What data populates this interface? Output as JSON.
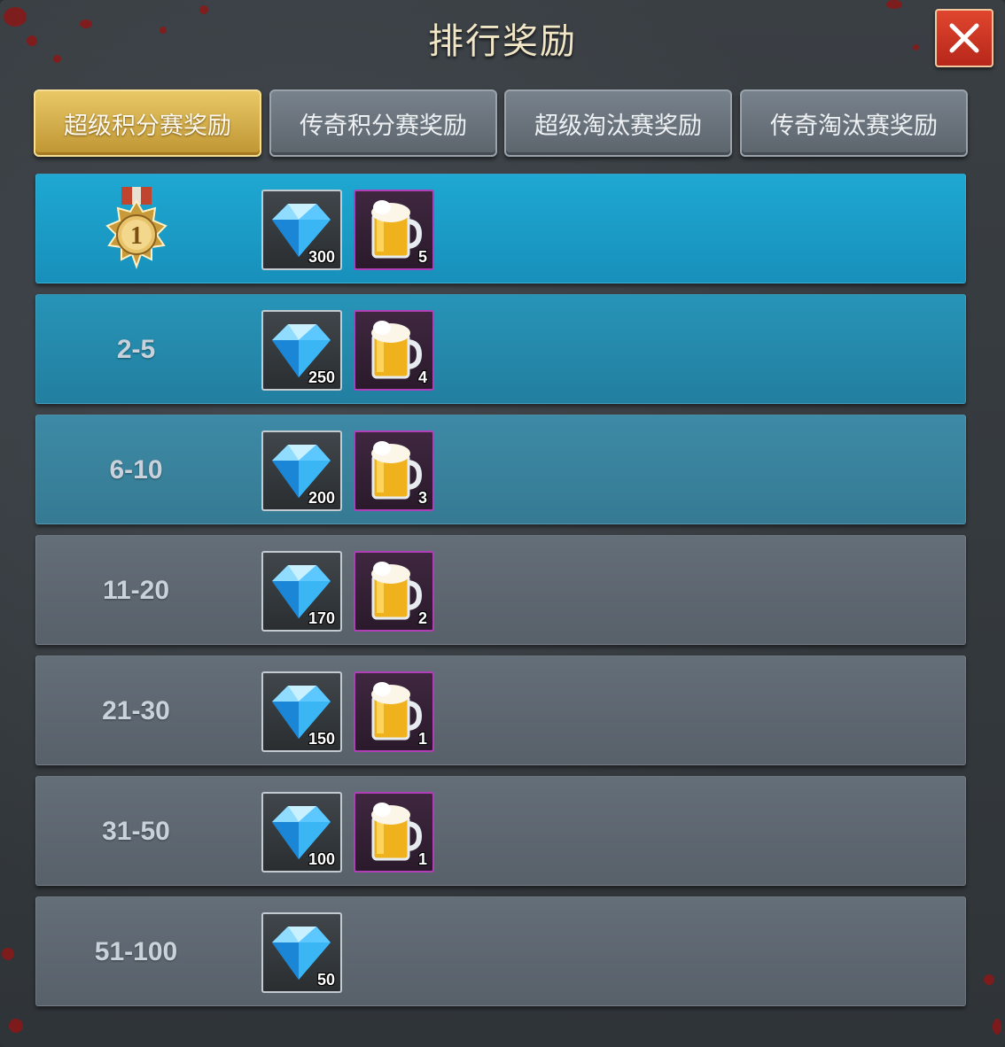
{
  "title": "排行奖励",
  "close_icon": "close-icon",
  "tabs": [
    {
      "label": "超级积分赛奖励",
      "active": true
    },
    {
      "label": "传奇积分赛奖励",
      "active": false
    },
    {
      "label": "超级淘汰赛奖励",
      "active": false
    },
    {
      "label": "传奇淘汰赛奖励",
      "active": false
    }
  ],
  "rows": [
    {
      "rank": "",
      "rank_icon": "gold-medal-rank-1-icon",
      "medal_number": "1",
      "gems": "300",
      "beer": "5"
    },
    {
      "rank": "2-5",
      "gems": "250",
      "beer": "4"
    },
    {
      "rank": "6-10",
      "gems": "200",
      "beer": "3"
    },
    {
      "rank": "11-20",
      "gems": "170",
      "beer": "2"
    },
    {
      "rank": "21-30",
      "gems": "150",
      "beer": "1"
    },
    {
      "rank": "31-50",
      "gems": "100",
      "beer": "1"
    },
    {
      "rank": "51-100",
      "gems": "50"
    }
  ],
  "colors": {
    "active_tab": "#d9b24c",
    "close_button": "#d23a25",
    "gem_frame": "#c4cbd0",
    "beer_frame": "#b13fb7",
    "row_top": "#1a9fc9",
    "row_bottom": "#5c6670"
  }
}
